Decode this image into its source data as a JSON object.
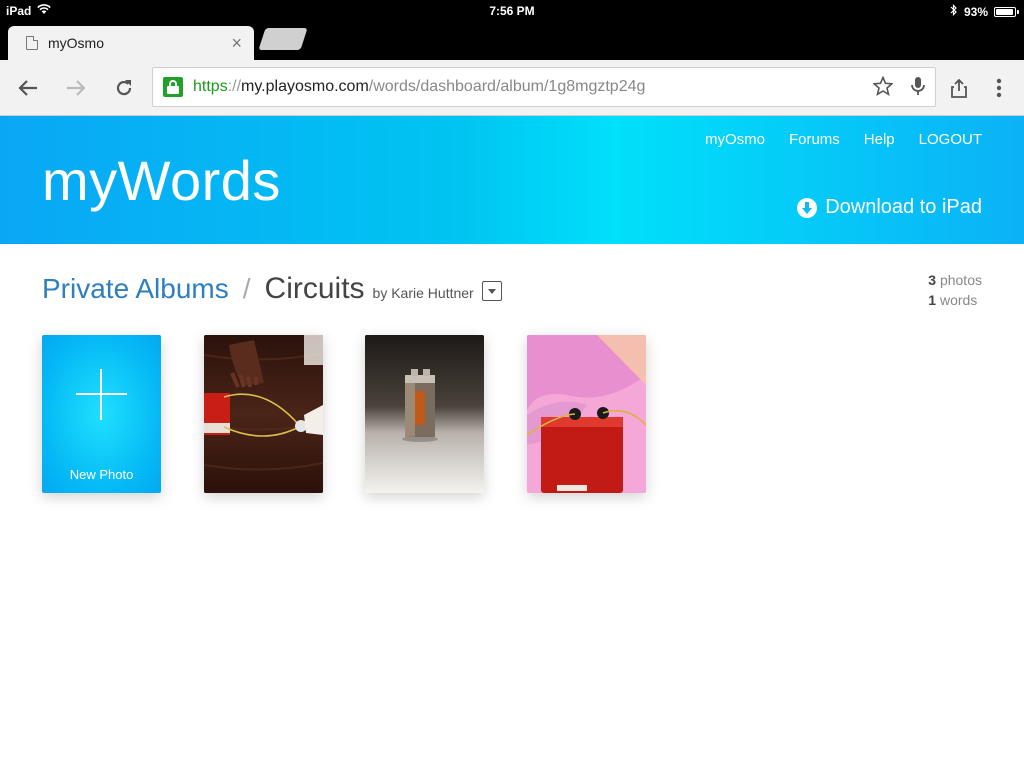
{
  "status_bar": {
    "device": "iPad",
    "time": "7:56 PM",
    "battery": "93%",
    "battery_level": 0.93
  },
  "browser": {
    "tab_title": "myOsmo",
    "url": {
      "scheme": "https",
      "separator": "://",
      "host": "my.playosmo.com",
      "path": "/words/dashboard/album/1g8mgztp24g"
    }
  },
  "header": {
    "logo": "myWords",
    "nav": [
      "myOsmo",
      "Forums",
      "Help",
      "LOGOUT"
    ],
    "download_label": "Download to iPad"
  },
  "breadcrumb": {
    "parent": "Private Albums",
    "separator": "/",
    "current": "Circuits",
    "byline": "by Karie Huttner"
  },
  "stats": {
    "photos_count": "3",
    "photos_label": "photos",
    "words_count": "1",
    "words_label": "words"
  },
  "cards": {
    "new_photo_label": "New Photo"
  },
  "colors": {
    "banner_start": "#0aa7f5",
    "banner_mid": "#00e0fa",
    "link_blue": "#2e7fc0",
    "secure_green": "#1fa12a"
  }
}
